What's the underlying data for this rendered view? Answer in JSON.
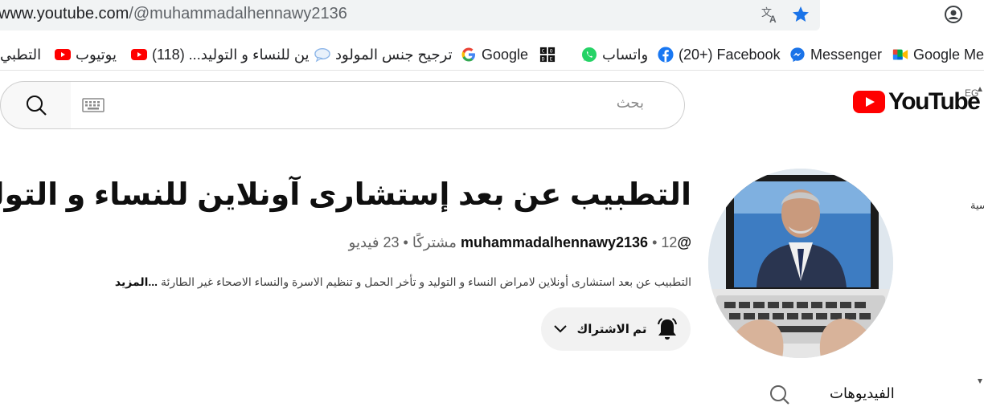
{
  "browser": {
    "url_prefix": "www.youtube.com",
    "url_path": "/@muhammadalhennawy2136",
    "icons": [
      "translate-icon",
      "star-icon",
      "profile-icon"
    ]
  },
  "bookmarks": [
    {
      "label": "التطبي",
      "icon": "folder"
    },
    {
      "label": "يوتيوب",
      "icon": "youtube"
    },
    {
      "label": "(118) ...ين للنساء و التوليد",
      "icon": "youtube"
    },
    {
      "label": "ترجيح جنس المولود",
      "icon": "chat"
    },
    {
      "label": "Google",
      "icon": "google"
    },
    {
      "label": "",
      "icon": "code"
    },
    {
      "label": "واتساب",
      "icon": "whatsapp"
    },
    {
      "label": "(20+) Facebook",
      "icon": "facebook"
    },
    {
      "label": "Messenger",
      "icon": "messenger"
    },
    {
      "label": "Google Mee",
      "icon": "meet"
    }
  ],
  "header": {
    "search_placeholder": "بحث",
    "logo_text": "YouTube",
    "country_code": "EG"
  },
  "channel": {
    "title": "التطبيب عن بعد إستشارى آونلاين للنساء و التوليد",
    "handle": "@muhammadalhennawy2136",
    "subscribers": "12 مشتركًا",
    "videos": "23 فيديو",
    "separator": "•",
    "description": "التطبيب عن بعد استشارى أونلاين لامراض النساء و التوليد و تأخر الحمل و تنظيم الاسرة والنساء الاصحاء  غير الطارئة",
    "more_label": "...المزيد",
    "subscribe_label": "تم الاشتراك"
  },
  "tabs": {
    "videos_label": "الفيديوهات"
  },
  "edge_text": "سية",
  "colors": {
    "youtube_red": "#ff0000",
    "star_blue": "#1a73e8",
    "facebook_blue": "#1877f2",
    "whatsapp_green": "#25d366"
  }
}
